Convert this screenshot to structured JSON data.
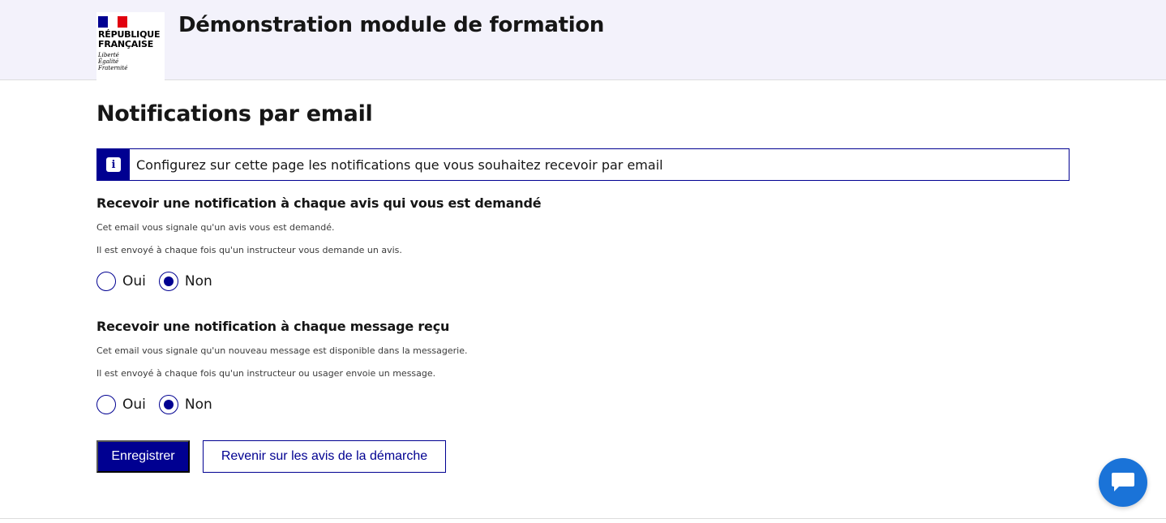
{
  "header": {
    "logo_line1": "RÉPUBLIQUE",
    "logo_line2": "FRANÇAISE",
    "motto": [
      "Liberté",
      "Égalité",
      "Fraternité"
    ],
    "site_title": "Démonstration module de formation"
  },
  "main": {
    "page_title": "Notifications par email",
    "alert": {
      "icon": "info-icon",
      "text": "Configurez sur cette page les notifications que vous souhaitez recevoir par email"
    },
    "sections": [
      {
        "title": "Recevoir une notification à chaque avis qui vous est demandé",
        "desc1": "Cet email vous signale qu'un avis vous est demandé.",
        "desc2": "Il est envoyé à chaque fois qu'un instructeur vous demande un avis.",
        "options": [
          {
            "label": "Oui",
            "checked": false
          },
          {
            "label": "Non",
            "checked": true
          }
        ]
      },
      {
        "title": "Recevoir une notification à chaque message reçu",
        "desc1": "Cet email vous signale qu'un nouveau message est disponible dans la messagerie.",
        "desc2": "Il est envoyé à chaque fois qu'un instructeur ou usager envoie un message.",
        "options": [
          {
            "label": "Oui",
            "checked": false
          },
          {
            "label": "Non",
            "checked": true
          }
        ]
      }
    ],
    "buttons": {
      "save_label": "Enregistrer",
      "back_label": "Revenir sur les avis de la démarche"
    }
  },
  "chat": {
    "icon": "chat-bubble-icon"
  },
  "colors": {
    "primary": "#000091",
    "header_bg": "#f3f2fb",
    "chat": "#1a73d8",
    "flag_red": "#e1000f"
  }
}
